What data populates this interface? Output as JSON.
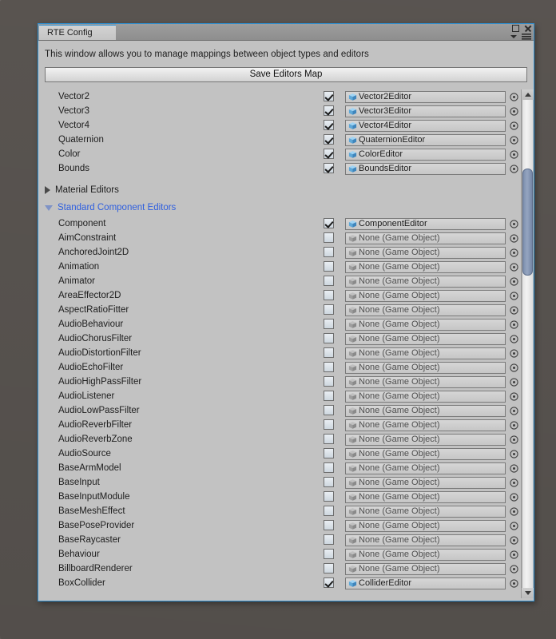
{
  "window": {
    "tab_label": "RTE Config",
    "description": "This window allows you to manage mappings between object types and editors",
    "save_button_label": "Save Editors Map",
    "controls": {
      "maximize": "maximize-icon",
      "close": "close-icon",
      "menu_caret": "caret-down-icon",
      "menu": "hamburger-menu-icon"
    },
    "accent_border_color": "#2f8fd0",
    "panel_color": "#c2c2c2",
    "link_color": "#2f5fdf"
  },
  "empty_field_label": "None (Game Object)",
  "top_rows": [
    {
      "label": "Vector2",
      "checked": true,
      "editor": "Vector2Editor",
      "assigned": true
    },
    {
      "label": "Vector3",
      "checked": true,
      "editor": "Vector3Editor",
      "assigned": true
    },
    {
      "label": "Vector4",
      "checked": true,
      "editor": "Vector4Editor",
      "assigned": true
    },
    {
      "label": "Quaternion",
      "checked": true,
      "editor": "QuaternionEditor",
      "assigned": true
    },
    {
      "label": "Color",
      "checked": true,
      "editor": "ColorEditor",
      "assigned": true
    },
    {
      "label": "Bounds",
      "checked": true,
      "editor": "BoundsEditor",
      "assigned": true
    }
  ],
  "foldouts": [
    {
      "label": "Material Editors",
      "expanded": false,
      "highlighted": false
    },
    {
      "label": "Standard Component Editors",
      "expanded": true,
      "highlighted": true
    }
  ],
  "component_rows": [
    {
      "label": "Component",
      "checked": true,
      "editor": "ComponentEditor",
      "assigned": true
    },
    {
      "label": "AimConstraint",
      "checked": false,
      "editor": "None (Game Object)",
      "assigned": false
    },
    {
      "label": "AnchoredJoint2D",
      "checked": false,
      "editor": "None (Game Object)",
      "assigned": false
    },
    {
      "label": "Animation",
      "checked": false,
      "editor": "None (Game Object)",
      "assigned": false
    },
    {
      "label": "Animator",
      "checked": false,
      "editor": "None (Game Object)",
      "assigned": false
    },
    {
      "label": "AreaEffector2D",
      "checked": false,
      "editor": "None (Game Object)",
      "assigned": false
    },
    {
      "label": "AspectRatioFitter",
      "checked": false,
      "editor": "None (Game Object)",
      "assigned": false
    },
    {
      "label": "AudioBehaviour",
      "checked": false,
      "editor": "None (Game Object)",
      "assigned": false
    },
    {
      "label": "AudioChorusFilter",
      "checked": false,
      "editor": "None (Game Object)",
      "assigned": false
    },
    {
      "label": "AudioDistortionFilter",
      "checked": false,
      "editor": "None (Game Object)",
      "assigned": false
    },
    {
      "label": "AudioEchoFilter",
      "checked": false,
      "editor": "None (Game Object)",
      "assigned": false
    },
    {
      "label": "AudioHighPassFilter",
      "checked": false,
      "editor": "None (Game Object)",
      "assigned": false
    },
    {
      "label": "AudioListener",
      "checked": false,
      "editor": "None (Game Object)",
      "assigned": false
    },
    {
      "label": "AudioLowPassFilter",
      "checked": false,
      "editor": "None (Game Object)",
      "assigned": false
    },
    {
      "label": "AudioReverbFilter",
      "checked": false,
      "editor": "None (Game Object)",
      "assigned": false
    },
    {
      "label": "AudioReverbZone",
      "checked": false,
      "editor": "None (Game Object)",
      "assigned": false
    },
    {
      "label": "AudioSource",
      "checked": false,
      "editor": "None (Game Object)",
      "assigned": false
    },
    {
      "label": "BaseArmModel",
      "checked": false,
      "editor": "None (Game Object)",
      "assigned": false
    },
    {
      "label": "BaseInput",
      "checked": false,
      "editor": "None (Game Object)",
      "assigned": false
    },
    {
      "label": "BaseInputModule",
      "checked": false,
      "editor": "None (Game Object)",
      "assigned": false
    },
    {
      "label": "BaseMeshEffect",
      "checked": false,
      "editor": "None (Game Object)",
      "assigned": false
    },
    {
      "label": "BasePoseProvider",
      "checked": false,
      "editor": "None (Game Object)",
      "assigned": false
    },
    {
      "label": "BaseRaycaster",
      "checked": false,
      "editor": "None (Game Object)",
      "assigned": false
    },
    {
      "label": "Behaviour",
      "checked": false,
      "editor": "None (Game Object)",
      "assigned": false
    },
    {
      "label": "BillboardRenderer",
      "checked": false,
      "editor": "None (Game Object)",
      "assigned": false
    },
    {
      "label": "BoxCollider",
      "checked": true,
      "editor": "ColliderEditor",
      "assigned": true
    }
  ],
  "scrollbar": {
    "up_arrow": "scroll-up-icon",
    "down_arrow": "scroll-down-icon",
    "thumb_top_pct": 14,
    "thumb_height_pct": 22
  }
}
